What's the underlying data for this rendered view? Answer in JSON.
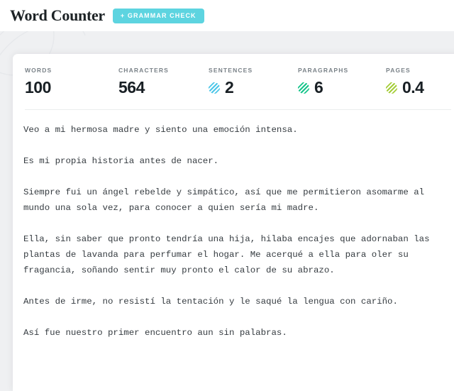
{
  "header": {
    "brand": "Word Counter",
    "grammar_button": "+ Grammar Check",
    "brand_color": "#1d2326",
    "button_color": "#5dd4e0"
  },
  "stats": [
    {
      "label": "Words",
      "value": "100",
      "icon": null,
      "icon_color": null
    },
    {
      "label": "Characters",
      "value": "564",
      "icon": null,
      "icon_color": null
    },
    {
      "label": "Sentences",
      "value": "2",
      "icon": "striped-circle-icon",
      "icon_color": "#4cc6e8"
    },
    {
      "label": "Paragraphs",
      "value": "6",
      "icon": "striped-circle-icon",
      "icon_color": "#17c48b"
    },
    {
      "label": "Pages",
      "value": "0.4",
      "icon": "striped-circle-icon",
      "icon_color": "#a5cd39"
    }
  ],
  "document": {
    "paragraphs": [
      "Veo a mi hermosa madre y siento una emoción intensa.",
      "Es mi propia historia antes de nacer.",
      "Siempre fui un ángel rebelde y simpático, así que me permitieron asomarme al mundo una sola vez, para conocer a quien sería mi madre.",
      "Ella, sin saber que pronto tendría una hija, hilaba encajes que adornaban las plantas de lavanda para perfumar el hogar. Me acerqué a ella para oler su fragancia, soñando sentir muy pronto el calor de su abrazo.",
      "Antes de irme, no resistí la tentación y le saqué la lengua con cariño.",
      "Así fue nuestro primer encuentro aun sin palabras."
    ]
  }
}
